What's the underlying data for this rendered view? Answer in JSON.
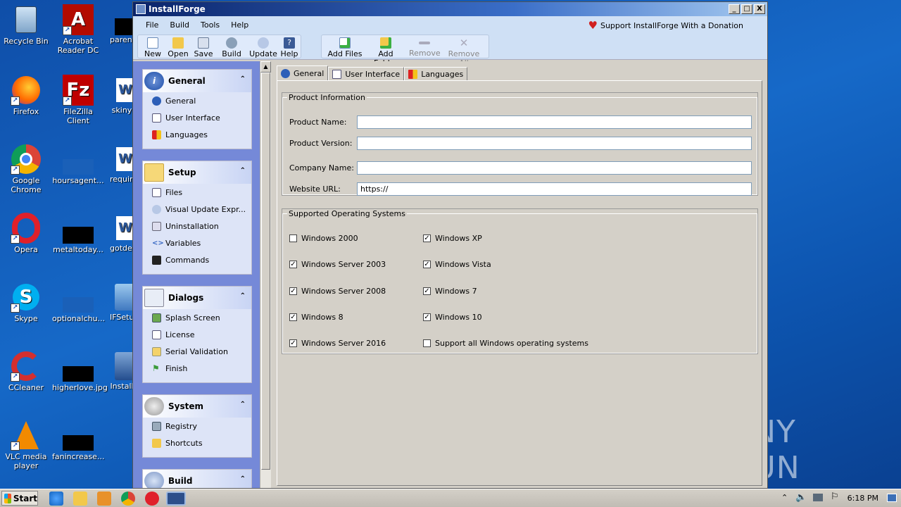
{
  "desktop": {
    "icons": [
      {
        "label": "Recycle Bin"
      },
      {
        "label": "Acrobat Reader DC"
      },
      {
        "label": "parent"
      },
      {
        "label": "Firefox"
      },
      {
        "label": "FileZilla Client"
      },
      {
        "label": "skiny"
      },
      {
        "label": "Google Chrome"
      },
      {
        "label": "hoursagent..."
      },
      {
        "label": "require"
      },
      {
        "label": "Opera"
      },
      {
        "label": "metaltoday..."
      },
      {
        "label": "gotdev"
      },
      {
        "label": "Skype"
      },
      {
        "label": "optionalchu..."
      },
      {
        "label": "IFSetu"
      },
      {
        "label": "CCleaner"
      },
      {
        "label": "higherlove.jpg"
      },
      {
        "label": "Install"
      },
      {
        "label": "VLC media player"
      },
      {
        "label": "fanincrease..."
      }
    ],
    "watermark": "ANY RUN"
  },
  "window": {
    "title": "InstallForge",
    "min_label": "_",
    "max_label": "□",
    "close_label": "X"
  },
  "menu": [
    "File",
    "Build",
    "Tools",
    "Help"
  ],
  "support_link": "Support InstallForge With a Donation",
  "toolbar": {
    "new": "New",
    "open": "Open",
    "save": "Save",
    "build": "Build",
    "update": "Update",
    "help": "Help",
    "add_files": "Add Files",
    "add_folder": "Add Folder",
    "remove": "Remove",
    "remove_all": "Remove All"
  },
  "sidebar": {
    "groups": [
      {
        "title": "General",
        "items": [
          "General",
          "User Interface",
          "Languages"
        ]
      },
      {
        "title": "Setup",
        "items": [
          "Files",
          "Visual Update Expr...",
          "Uninstallation",
          "Variables",
          "Commands"
        ]
      },
      {
        "title": "Dialogs",
        "items": [
          "Splash Screen",
          "License",
          "Serial Validation",
          "Finish"
        ]
      },
      {
        "title": "System",
        "items": [
          "Registry",
          "Shortcuts"
        ]
      },
      {
        "title": "Build",
        "items": []
      }
    ]
  },
  "tabs": [
    "General",
    "User Interface",
    "Languages"
  ],
  "product_info": {
    "legend": "Product Information",
    "name_label": "Product Name:",
    "name_value": "",
    "version_label": "Product Version:",
    "version_value": "",
    "company_label": "Company Name:",
    "company_value": "",
    "url_label": "Website URL:",
    "url_value": "https://"
  },
  "os": {
    "legend": "Supported Operating Systems",
    "items": [
      {
        "label": "Windows 2000",
        "checked": false
      },
      {
        "label": "Windows XP",
        "checked": true
      },
      {
        "label": "Windows Server 2003",
        "checked": true
      },
      {
        "label": "Windows Vista",
        "checked": true
      },
      {
        "label": "Windows Server 2008",
        "checked": true
      },
      {
        "label": "Windows 7",
        "checked": true
      },
      {
        "label": "Windows 8",
        "checked": true
      },
      {
        "label": "Windows 10",
        "checked": true
      },
      {
        "label": "Windows Server 2016",
        "checked": true
      },
      {
        "label": "Support all Windows operating systems",
        "checked": false
      }
    ]
  },
  "taskbar": {
    "start": "Start",
    "clock": "6:18 PM"
  },
  "colors": {
    "desktop": "#1669c8",
    "sidebar": "#7589d8",
    "titlebar": "#0a246a"
  }
}
